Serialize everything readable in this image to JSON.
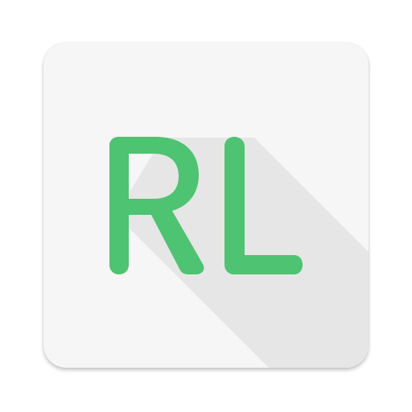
{
  "icon": {
    "monogram": "RL",
    "colors": {
      "background": "#f6f6f6",
      "letters": "#4ec372",
      "long_shadow": "#e6e6e6"
    }
  }
}
